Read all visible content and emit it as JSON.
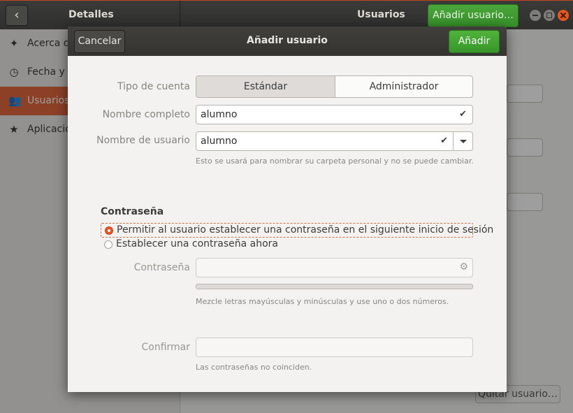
{
  "background": {
    "back_icon": "chevron-left-icon",
    "left_title": "Detalles",
    "right_title": "Usuarios",
    "add_user_button": "Añadir usuario…",
    "remove_user_button": "Quitar usuario…",
    "sidebar": [
      {
        "label": "Acerca de",
        "icon": "sparkle-icon"
      },
      {
        "label": "Fecha y hora",
        "icon": "clock-icon"
      },
      {
        "label": "Usuarios",
        "icon": "users-icon",
        "active": true
      },
      {
        "label": "Aplicaciones predeterminadas",
        "icon": "star-icon"
      }
    ],
    "colors": {
      "accent": "#e9541f",
      "sidebar_active": "#e2693f",
      "green": "#3a962b"
    }
  },
  "dialog": {
    "title": "Añadir usuario",
    "cancel": "Cancelar",
    "add": "Añadir",
    "account_type_label": "Tipo de cuenta",
    "account_type_options": [
      "Estándar",
      "Administrador"
    ],
    "account_type_selected": "Estándar",
    "full_name_label": "Nombre completo",
    "full_name_value": "alumno",
    "username_label": "Nombre de usuario",
    "username_value": "alumno",
    "username_hint": "Esto se usará para nombrar su carpeta personal y no se puede cambiar.",
    "password_section": "Contraseña",
    "option_next_login": "Permitir al usuario establecer una contraseña en el siguiente inicio de sesión",
    "option_now": "Establecer una contraseña ahora",
    "selected_option": "next_login",
    "password_label": "Contraseña",
    "password_hint": "Mezcle letras mayúsculas y minúsculas y use uno o dos números.",
    "confirm_label": "Confirmar",
    "confirm_hint": "Las contraseñas no coinciden."
  }
}
